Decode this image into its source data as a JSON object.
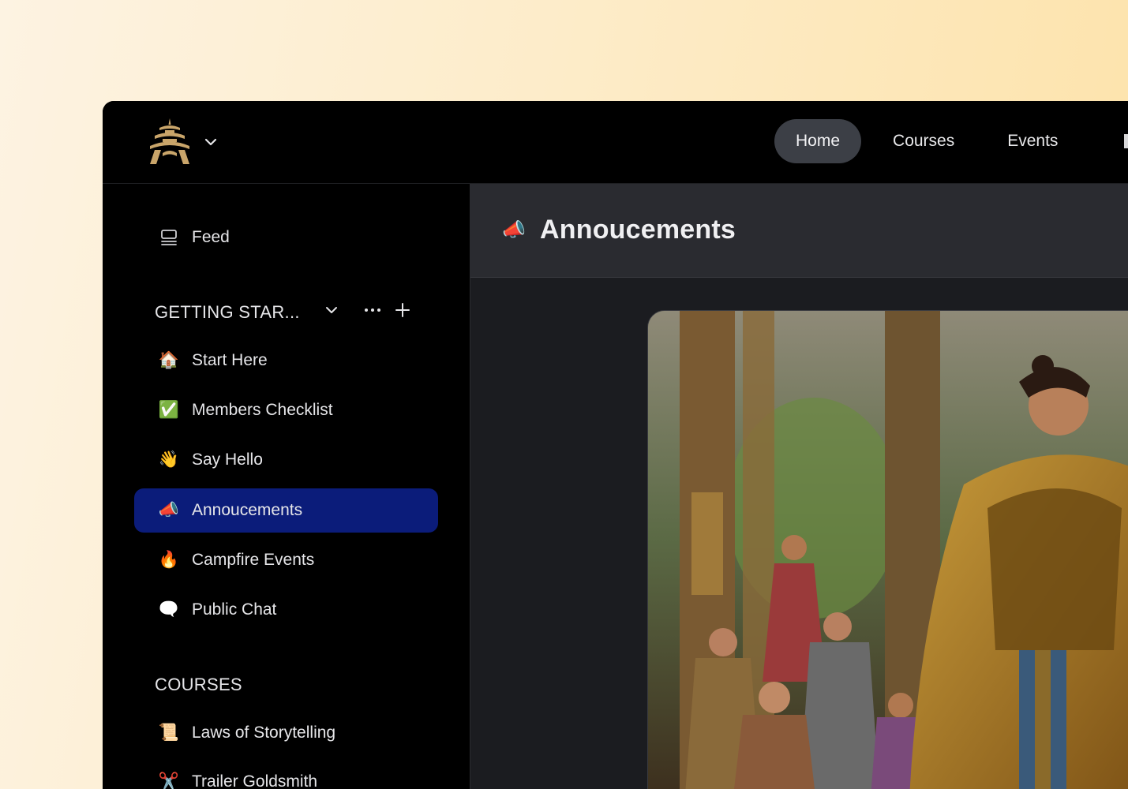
{
  "nav": {
    "items": [
      {
        "label": "Home",
        "active": true
      },
      {
        "label": "Courses",
        "active": false
      },
      {
        "label": "Events",
        "active": false
      }
    ]
  },
  "sidebar": {
    "feed": {
      "label": "Feed",
      "icon": "feed-icon"
    },
    "section1": {
      "title": "GETTING STAR..."
    },
    "items": [
      {
        "label": "Start Here",
        "icon": "🏠"
      },
      {
        "label": "Members Checklist",
        "icon": "✅"
      },
      {
        "label": "Say Hello",
        "icon": "👋"
      },
      {
        "label": "Annoucements",
        "icon": "📣",
        "active": true
      },
      {
        "label": "Campfire Events",
        "icon": "🔥"
      },
      {
        "label": "Public Chat",
        "icon": "🗨️"
      }
    ],
    "section2": {
      "title": "COURSES"
    },
    "courses": [
      {
        "label": "Laws of Storytelling",
        "icon": "📜"
      },
      {
        "label": "Trailer Goldsmith",
        "icon": "✂️"
      }
    ]
  },
  "content": {
    "title": "Annoucements",
    "icon": "📣"
  },
  "colors": {
    "accent_active": "#0b1c7a",
    "logo_gold": "#c9a56a"
  }
}
